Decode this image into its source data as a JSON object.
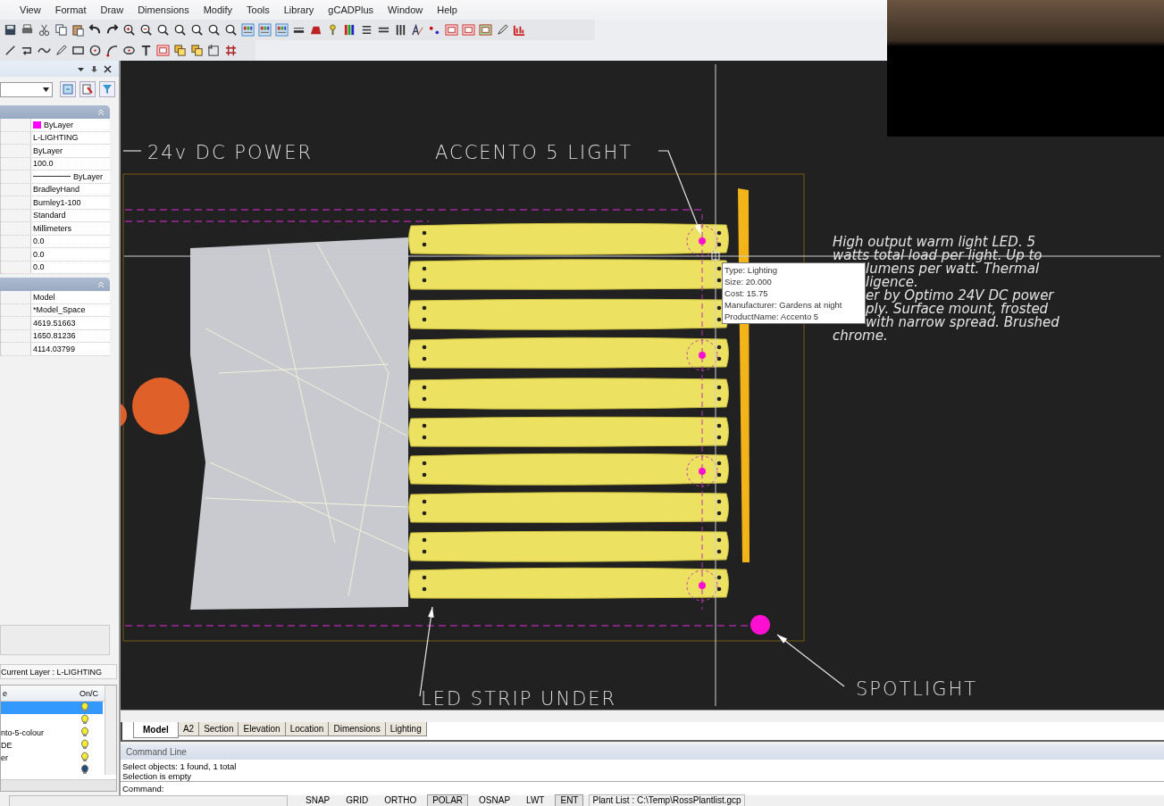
{
  "menu": [
    "View",
    "Format",
    "Draw",
    "Dimensions",
    "Modify",
    "Tools",
    "Library",
    "gCADPlus",
    "Window",
    "Help"
  ],
  "properties_panel": {
    "sections": [
      {
        "rows": [
          {
            "value": "ByLayer",
            "color": "#ff00ff"
          },
          {
            "value": "L-LIGHTING"
          },
          {
            "value": "ByLayer"
          },
          {
            "value": "100.0"
          },
          {
            "value": "ByLayer",
            "kind": "linetype"
          },
          {
            "value": "BradleyHand"
          },
          {
            "value": "Burnley1-100"
          },
          {
            "value": "Standard"
          },
          {
            "value": "Millimeters"
          },
          {
            "value": "0.0"
          },
          {
            "value": "0.0"
          },
          {
            "value": "0.0"
          }
        ]
      },
      {
        "rows": [
          {
            "value": "Model"
          },
          {
            "value": "*Model_Space"
          },
          {
            "value": "4619.51663"
          },
          {
            "value": "1650.81236"
          },
          {
            "value": "4114.03799"
          }
        ]
      }
    ]
  },
  "layer_panel": {
    "current_layer": "Current Layer : L-LIGHTING",
    "columns": [
      "e",
      "On/C"
    ],
    "rows": [
      {
        "on": true,
        "selected": true
      },
      {
        "on": true,
        "selected": false
      },
      {
        "name": "nto-5-colour",
        "on": true,
        "selected": false
      },
      {
        "name": "DE",
        "on": true,
        "selected": false
      },
      {
        "name": "er",
        "on": true,
        "selected": false
      },
      {
        "on": false,
        "selected": false
      }
    ]
  },
  "drawing": {
    "labels": [
      {
        "kind": "power",
        "text": "24v DC POWER"
      },
      {
        "kind": "light",
        "text": "ACCENTO 5 LIGHT"
      },
      {
        "kind": "spot",
        "text": "SPOTLIGHT"
      },
      {
        "kind": "strip",
        "text": "LED STRIP UNDER"
      }
    ],
    "note_lines": [
      "High output warm light LED. 5",
      "watts total load per light. Up to",
      "lumens per watt. Thermal",
      "ligence.",
      "er by Optimo 24V DC power",
      "ply. Surface mount, frosted",
      "with narrow spread. Brushed",
      "chrome."
    ],
    "tooltip": [
      "Type: Lighting",
      "Size: 20.000",
      "Cost: 15.75",
      "Manufacturer: Gardens at night",
      "ProductName: Accento 5"
    ]
  },
  "tabs": [
    {
      "label": "Model",
      "selected": true
    },
    {
      "label": "A2",
      "selected": false
    },
    {
      "label": "Section",
      "selected": false
    },
    {
      "label": "Elevation",
      "selected": false
    },
    {
      "label": "Location",
      "selected": false
    },
    {
      "label": "Dimensions",
      "selected": false
    },
    {
      "label": "Lighting",
      "selected": false
    }
  ],
  "command_line": {
    "title": "Command Line",
    "lines": [
      "Select objects: 1 found,  1 total",
      "Selection is empty"
    ],
    "prompt": "Command:"
  },
  "status_bar": {
    "buttons": [
      {
        "label": "SNAP",
        "on": false
      },
      {
        "label": "GRID",
        "on": false
      },
      {
        "label": "ORTHO",
        "on": false
      },
      {
        "label": "POLAR",
        "on": true
      },
      {
        "label": "OSNAP",
        "on": false
      },
      {
        "label": "LWT",
        "on": false
      },
      {
        "label": "ENT",
        "on": true
      }
    ],
    "text": "Plant List : C:\\Temp\\RossPlantlist.gcp"
  }
}
